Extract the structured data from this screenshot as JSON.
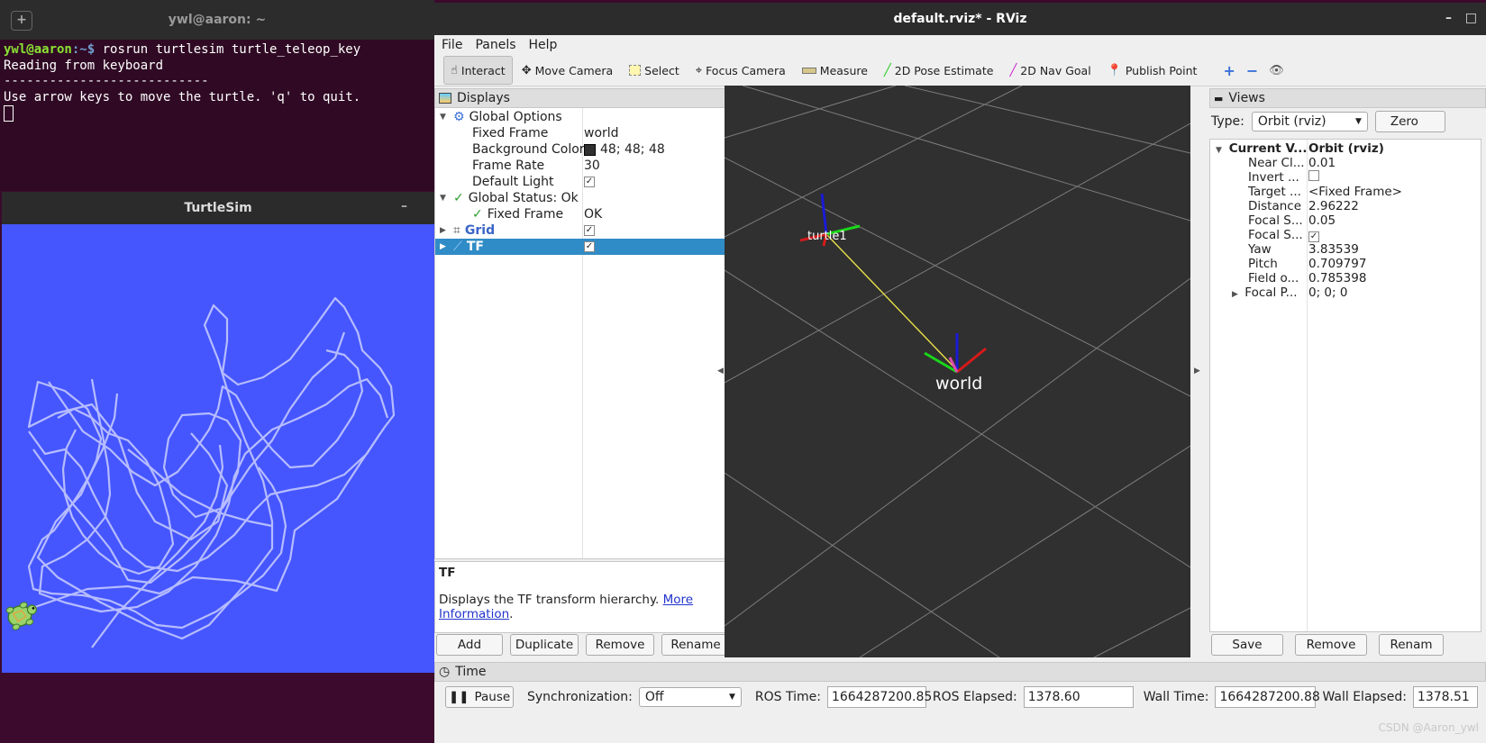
{
  "terminal": {
    "title": "ywl@aaron: ~",
    "prompt_user": "ywl@aaron",
    "prompt_path": ":~$",
    "command": " rosrun turtlesim turtle_teleop_key",
    "line1": "Reading from keyboard",
    "line2": "---------------------------",
    "line3": "Use arrow keys to move the turtle. 'q' to quit."
  },
  "turtlesim": {
    "title": "TurtleSim",
    "background_color": "#4556ff",
    "trail_color": "#b3b9ff"
  },
  "rviz": {
    "title": "default.rviz* - RViz",
    "menu": [
      "File",
      "Panels",
      "Help"
    ],
    "toolbar": {
      "interact": "Interact",
      "move_camera": "Move Camera",
      "select": "Select",
      "focus_camera": "Focus Camera",
      "measure": "Measure",
      "pose_estimate": "2D Pose Estimate",
      "nav_goal": "2D Nav Goal",
      "publish_point": "Publish Point"
    },
    "displays": {
      "title": "Displays",
      "global_options": "Global Options",
      "fixed_frame_label": "Fixed Frame",
      "fixed_frame_value": "world",
      "bg_color_label": "Background Color",
      "bg_color_value": "48; 48; 48",
      "frame_rate_label": "Frame Rate",
      "frame_rate_value": "30",
      "default_light_label": "Default Light",
      "global_status": "Global Status: Ok",
      "status_fixed_frame": "Fixed Frame",
      "status_fixed_frame_value": "OK",
      "grid": "Grid",
      "tf": "TF"
    },
    "description": {
      "title": "TF",
      "text": "Displays the TF transform hierarchy. ",
      "link1": "More",
      "link2": "Information",
      "period": "."
    },
    "display_buttons": {
      "add": "Add",
      "duplicate": "Duplicate",
      "remove": "Remove",
      "rename": "Rename"
    },
    "view3d": {
      "turtle_label": "turtle1",
      "world_label": "world",
      "background": "#303030"
    },
    "views": {
      "title": "Views",
      "type_label": "Type:",
      "type_value": "Orbit (rviz)",
      "zero_button": "Zero",
      "rows": [
        {
          "k": "Current V...",
          "v": "Orbit (rviz)"
        },
        {
          "k": "Near Cl...",
          "v": "0.01"
        },
        {
          "k": "Invert ...",
          "v": ""
        },
        {
          "k": "Target ...",
          "v": "<Fixed Frame>"
        },
        {
          "k": "Distance",
          "v": "2.96222"
        },
        {
          "k": "Focal S...",
          "v": "0.05"
        },
        {
          "k": "Focal S...",
          "v": ""
        },
        {
          "k": "Yaw",
          "v": "3.83539"
        },
        {
          "k": "Pitch",
          "v": "0.709797"
        },
        {
          "k": "Field o...",
          "v": "0.785398"
        },
        {
          "k": "Focal P...",
          "v": "0; 0; 0"
        }
      ],
      "buttons": {
        "save": "Save",
        "remove": "Remove",
        "rename": "Renam"
      }
    },
    "time": {
      "title": "Time",
      "pause": "Pause",
      "sync_label": "Synchronization:",
      "sync_value": "Off",
      "ros_time_label": "ROS Time:",
      "ros_time_value": "1664287200.85",
      "ros_elapsed_label": "ROS Elapsed:",
      "ros_elapsed_value": "1378.60",
      "wall_time_label": "Wall Time:",
      "wall_time_value": "1664287200.88",
      "wall_elapsed_label": "Wall Elapsed:",
      "wall_elapsed_value": "1378.51"
    },
    "watermark": "CSDN @Aaron_ywl"
  }
}
